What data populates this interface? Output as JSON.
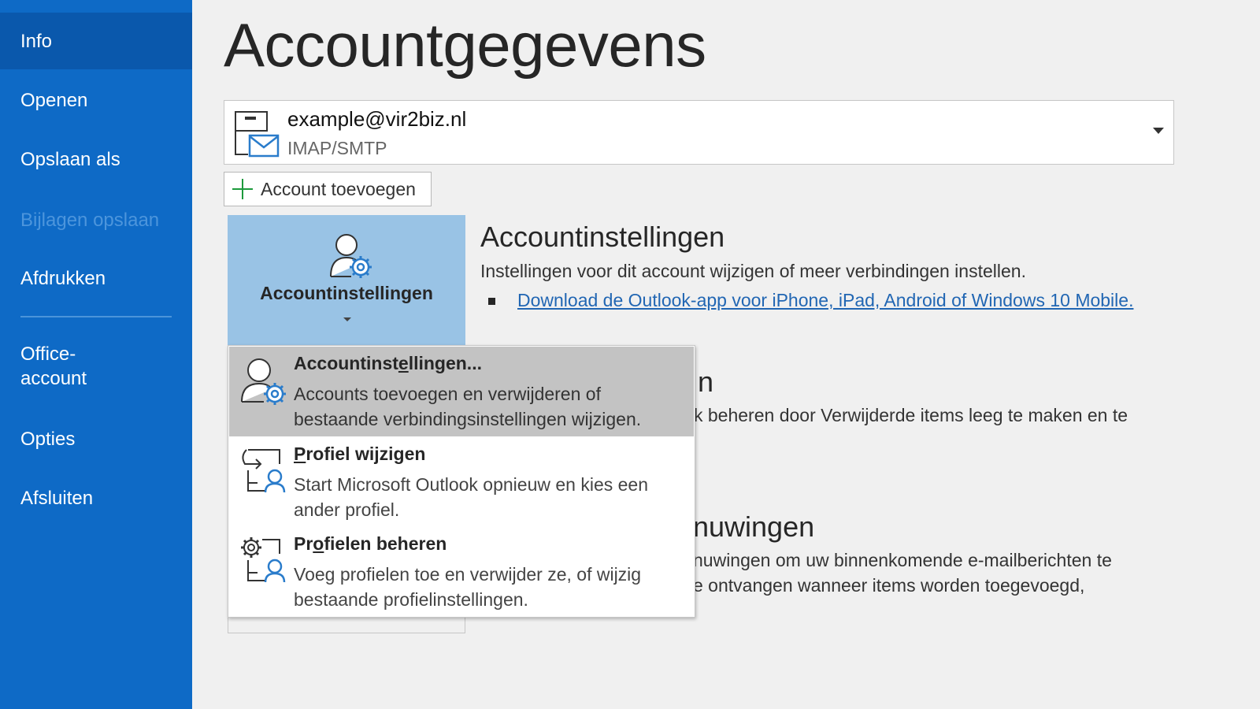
{
  "sidebar": {
    "items": [
      {
        "label": "Info"
      },
      {
        "label": "Openen"
      },
      {
        "label": "Opslaan als"
      },
      {
        "label": "Bijlagen opslaan"
      },
      {
        "label": "Afdrukken"
      },
      {
        "label": "Office-\naccount"
      },
      {
        "label": "Opties"
      },
      {
        "label": "Afsluiten"
      }
    ]
  },
  "main": {
    "title": "Accountgegevens",
    "account": {
      "email": "example@vir2biz.nl",
      "type": "IMAP/SMTP"
    },
    "add_account_label": "Account toevoegen",
    "account_settings_button": "Accountinstellingen",
    "section1": {
      "title": "Accountinstellingen",
      "desc": "Instellingen voor dit account wijzigen of meer verbindingen instellen.",
      "link": "Download de Outlook-app voor iPhone, iPad, Android of Windows 10 Mobile."
    },
    "section2": {
      "title_fragment": "n",
      "desc_fragment": "k beheren door Verwijderde items leeg te maken en te"
    },
    "section3": {
      "title_fragment": "nuwingen",
      "desc_line1": "nuwingen om uw binnenkomende e-mailberichten te",
      "desc_line2": "e ontvangen wanneer items worden toegevoegd,"
    }
  },
  "menu": {
    "items": [
      {
        "title_pre": "Accountinst",
        "title_u": "e",
        "title_post": "llingen...",
        "desc": "Accounts toevoegen en verwijderen of bestaande verbindingsinstellingen wijzigen."
      },
      {
        "title_pre": "",
        "title_u": "P",
        "title_post": "rofiel wijzigen",
        "desc": "Start  Microsoft Outlook opnieuw en kies een ander profiel."
      },
      {
        "title_pre": "Pr",
        "title_u": "o",
        "title_post": "fielen beheren",
        "desc": "Voeg profielen toe en verwijder ze, of wijzig bestaande profielinstellingen."
      }
    ]
  },
  "colors": {
    "sidebar": "#0e6ac6",
    "sidebar_active": "#0a58ac",
    "button_highlight": "#99c3e5",
    "link": "#2166b3"
  }
}
